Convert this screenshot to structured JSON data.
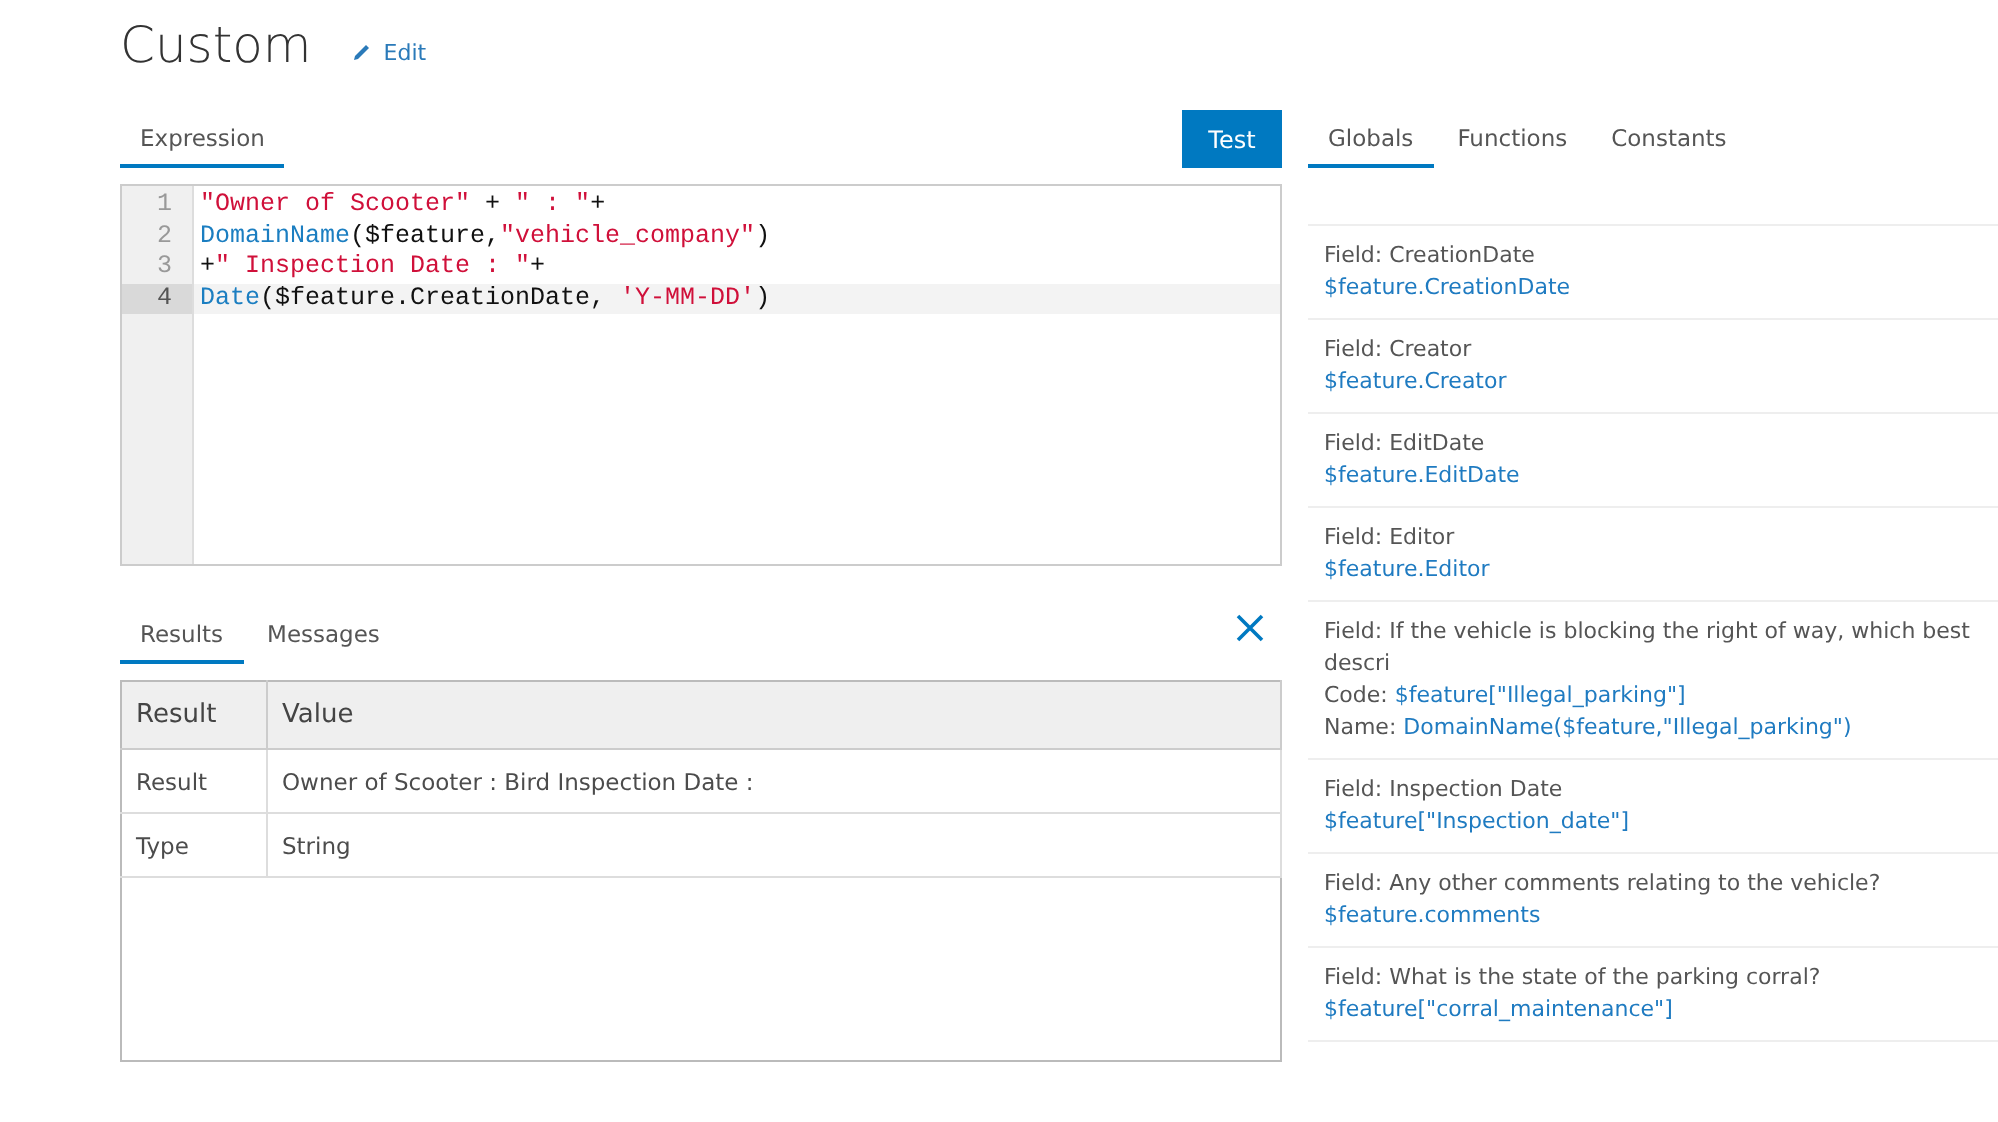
{
  "header": {
    "title": "Custom",
    "edit_link": "Edit"
  },
  "expression_tabs": [
    {
      "label": "Expression",
      "selected": true
    }
  ],
  "test_button": "Test",
  "editor": {
    "lines": [
      {
        "number": "1",
        "active": false,
        "tokens": [
          {
            "kind": "string",
            "text": "\"Owner of Scooter\""
          },
          {
            "kind": "plain",
            "text": " + "
          },
          {
            "kind": "string",
            "text": "\" : \""
          },
          {
            "kind": "plain",
            "text": "+"
          }
        ]
      },
      {
        "number": "2",
        "active": false,
        "tokens": [
          {
            "kind": "function",
            "text": "DomainName"
          },
          {
            "kind": "plain",
            "text": "($feature,"
          },
          {
            "kind": "string",
            "text": "\"vehicle_company\""
          },
          {
            "kind": "plain",
            "text": ")"
          }
        ]
      },
      {
        "number": "3",
        "active": false,
        "tokens": [
          {
            "kind": "plain",
            "text": "+"
          },
          {
            "kind": "string",
            "text": "\" Inspection Date : \""
          },
          {
            "kind": "plain",
            "text": "+"
          }
        ]
      },
      {
        "number": "4",
        "active": true,
        "tokens": [
          {
            "kind": "function",
            "text": "Date"
          },
          {
            "kind": "plain",
            "text": "($feature.CreationDate, "
          },
          {
            "kind": "string",
            "text": "'Y-MM-DD'"
          },
          {
            "kind": "plain",
            "text": ")"
          }
        ]
      }
    ]
  },
  "result_tabs": [
    {
      "label": "Results",
      "selected": true
    },
    {
      "label": "Messages",
      "selected": false
    }
  ],
  "results_table": {
    "columns": [
      "Result",
      "Value"
    ],
    "rows": [
      [
        "Result",
        "Owner of Scooter : Bird Inspection Date :"
      ],
      [
        "Type",
        "String"
      ]
    ]
  },
  "reference_tabs": [
    {
      "label": "Globals",
      "selected": true
    },
    {
      "label": "Functions",
      "selected": false
    },
    {
      "label": "Constants",
      "selected": false
    }
  ],
  "globals": [
    {
      "title": "Field: CreationDate",
      "values": [
        {
          "text": "$feature.CreationDate"
        }
      ]
    },
    {
      "title": "Field: Creator",
      "values": [
        {
          "text": "$feature.Creator"
        }
      ]
    },
    {
      "title": "Field: EditDate",
      "values": [
        {
          "text": "$feature.EditDate"
        }
      ]
    },
    {
      "title": "Field: Editor",
      "values": [
        {
          "text": "$feature.Editor"
        }
      ]
    },
    {
      "title": "Field: If the vehicle is blocking the right of way, which best descri",
      "values": [
        {
          "prefix": "Code:",
          "text": "$feature[\"Illegal_parking\"]"
        },
        {
          "prefix": "Name:",
          "text": "DomainName($feature,\"Illegal_parking\")"
        }
      ]
    },
    {
      "title": "Field: Inspection Date",
      "values": [
        {
          "text": "$feature[\"Inspection_date\"]"
        }
      ]
    },
    {
      "title": "Field: Any other comments relating to the vehicle?",
      "values": [
        {
          "text": "$feature.comments"
        }
      ]
    },
    {
      "title": "Field: What is the state of the parking corral?",
      "values": [
        {
          "text": "$feature[\"corral_maintenance\"]"
        }
      ]
    }
  ]
}
